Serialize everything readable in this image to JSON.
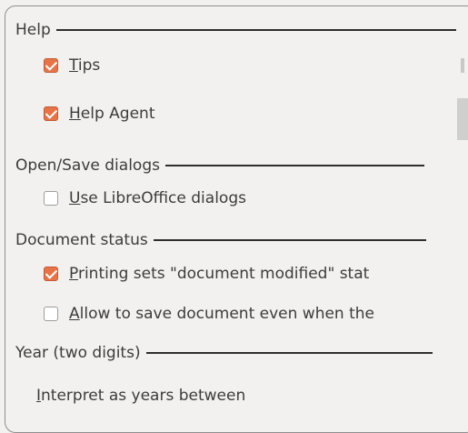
{
  "sections": {
    "help": {
      "title": "Help",
      "options": [
        {
          "first": "T",
          "rest": "ips",
          "checked": true
        },
        {
          "first": "H",
          "rest": "elp Agent",
          "checked": true
        }
      ]
    },
    "open_save": {
      "title": "Open/Save dialogs",
      "options": [
        {
          "first": "U",
          "rest": "se LibreOffice dialogs",
          "checked": false
        }
      ]
    },
    "document_status": {
      "title": "Document status",
      "options": [
        {
          "first": "P",
          "rest": "rinting sets \"document modified\" stat",
          "checked": true
        },
        {
          "first": "A",
          "rest": "llow to save document even when the",
          "checked": false
        }
      ]
    },
    "year": {
      "title": "Year (two digits)",
      "interpret_first": "I",
      "interpret_rest": "nterpret as years between"
    }
  },
  "colors": {
    "accent": "#e57449",
    "text": "#3c3c3c",
    "background": "#f2f1ef"
  }
}
